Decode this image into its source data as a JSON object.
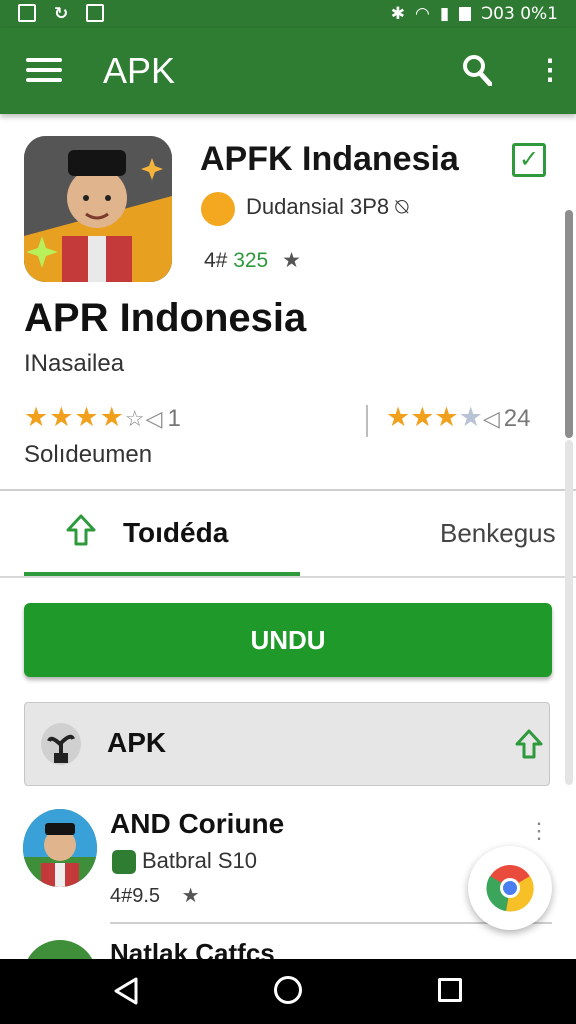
{
  "statusbar": {
    "time_text": "Ͻ03 0%1",
    "left_icons": [
      "photo-icon",
      "refresh-icon",
      "camera-icon"
    ],
    "right_icons": [
      "bluetooth-icon",
      "wifi-icon",
      "signal-icon",
      "battery-icon"
    ]
  },
  "appbar": {
    "title": "APK",
    "icons": [
      "menu-icon",
      "search-icon",
      "more-vert-icon"
    ],
    "color": "#2e7d32"
  },
  "app": {
    "name_top": "APFK Indanesia",
    "developer": "Dudansial 3P8 ⍉",
    "rating_prefix": "4#",
    "rating_value": "325",
    "rating_star": "★",
    "title": "APR Indonesia",
    "subtitle": "INasailea",
    "stars_left": "★★★★",
    "stars_left_tail": "☆◁",
    "stars_left_count": "1",
    "stars_right": "★★★",
    "stars_right_empty": "★",
    "stars_right_tail": "◁",
    "stars_right_count": "24",
    "stars_label": "Solıdeumen",
    "verified_check": "✓"
  },
  "tabs": [
    {
      "label": "Toıdéda",
      "selected": true,
      "icon": "upload-arrow-icon"
    },
    {
      "label": "Benkegus",
      "selected": false
    }
  ],
  "download_button": {
    "label": "UNDU",
    "color": "#1f9a2a"
  },
  "apk_row": {
    "label": "APK",
    "icon": "plant-icon",
    "trailing_icon": "upload-arrow-icon"
  },
  "list_items": [
    {
      "title": "AND Coriune",
      "subtitle": "Batbral S10",
      "rating_prefix": "4#",
      "rating_value": "9.5",
      "rating_star": "★"
    },
    {
      "title": "Natlak Catfcs"
    }
  ],
  "accent_color": "#2e9a3c",
  "star_color": "#f0a01c"
}
